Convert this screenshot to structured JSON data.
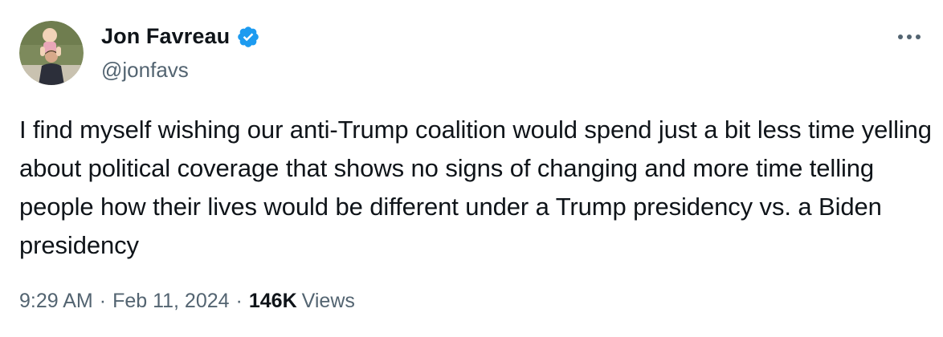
{
  "author": {
    "display_name": "Jon Favreau",
    "handle": "@jonfavs",
    "verified": true,
    "avatar_icon": "profile-photo"
  },
  "tweet": {
    "text": "I find myself wishing our anti-Trump coalition would spend just a bit less time yelling about political coverage that shows no signs of changing and more time telling people how their lives would be different under a Trump presidency vs. a Biden presidency",
    "time": "9:29 AM",
    "separator": "·",
    "date": "Feb 11, 2024",
    "views_count": "146K",
    "views_label": "Views"
  },
  "icons": {
    "more": "more-options-icon",
    "verified": "verified-badge-icon"
  },
  "colors": {
    "text_primary": "#0f1419",
    "text_secondary": "#536471",
    "verified_blue": "#1d9bf0"
  }
}
